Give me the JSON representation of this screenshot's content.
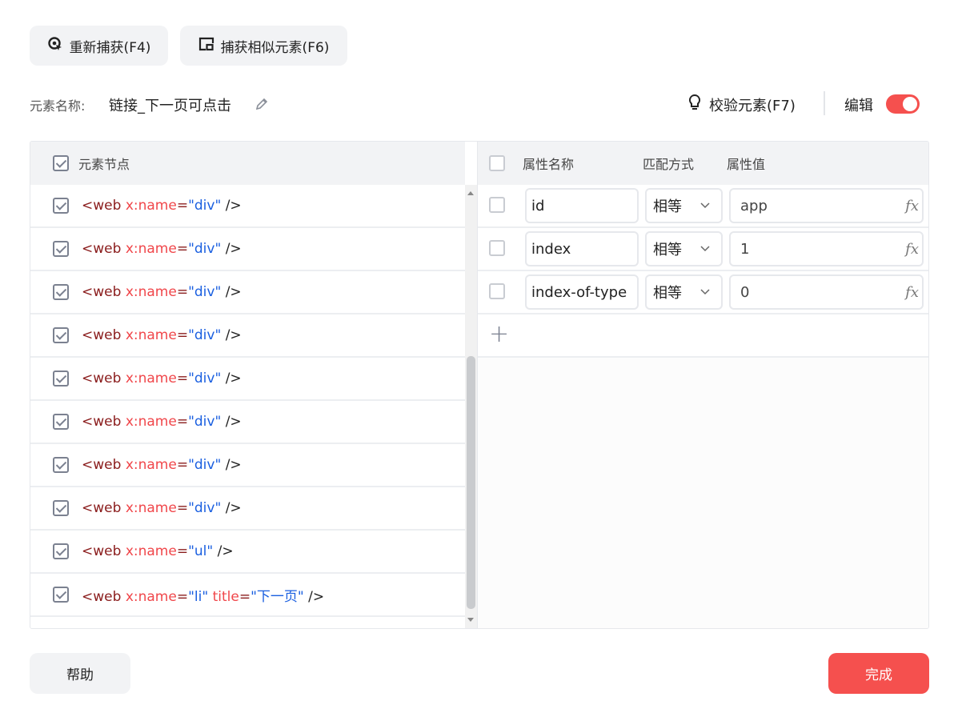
{
  "toolbar": {
    "recapture": "重新捕获(F4)",
    "capture_similar": "捕获相似元素(F6)"
  },
  "element": {
    "name_label": "元素名称:",
    "name_value": "链接_下一页可点击"
  },
  "verify": "校验元素(F7)",
  "edit": {
    "label": "编辑",
    "enabled": true
  },
  "left_header": "元素节点",
  "nodes": [
    {
      "tag": "web",
      "attrs": [
        {
          "k": "x:name",
          "v": "div"
        }
      ],
      "checked": true
    },
    {
      "tag": "web",
      "attrs": [
        {
          "k": "x:name",
          "v": "div"
        }
      ],
      "checked": true
    },
    {
      "tag": "web",
      "attrs": [
        {
          "k": "x:name",
          "v": "div"
        }
      ],
      "checked": true
    },
    {
      "tag": "web",
      "attrs": [
        {
          "k": "x:name",
          "v": "div"
        }
      ],
      "checked": true
    },
    {
      "tag": "web",
      "attrs": [
        {
          "k": "x:name",
          "v": "div"
        }
      ],
      "checked": true
    },
    {
      "tag": "web",
      "attrs": [
        {
          "k": "x:name",
          "v": "div"
        }
      ],
      "checked": true
    },
    {
      "tag": "web",
      "attrs": [
        {
          "k": "x:name",
          "v": "div"
        }
      ],
      "checked": true
    },
    {
      "tag": "web",
      "attrs": [
        {
          "k": "x:name",
          "v": "div"
        }
      ],
      "checked": true
    },
    {
      "tag": "web",
      "attrs": [
        {
          "k": "x:name",
          "v": "ul"
        }
      ],
      "checked": true
    },
    {
      "tag": "web",
      "attrs": [
        {
          "k": "x:name",
          "v": "li"
        },
        {
          "k": "title",
          "v": "下一页"
        }
      ],
      "checked": true
    }
  ],
  "right_header": {
    "name": "属性名称",
    "match": "匹配方式",
    "value": "属性值"
  },
  "attributes": [
    {
      "name": "id",
      "match": "相等",
      "value": "app",
      "checked": false
    },
    {
      "name": "index",
      "match": "相等",
      "value": "1",
      "checked": false
    },
    {
      "name": "index-of-type",
      "match": "相等",
      "value": "0",
      "checked": false
    }
  ],
  "fx": "fx",
  "footer": {
    "help": "帮助",
    "done": "完成"
  },
  "colors": {
    "accent": "#f5504e",
    "tag": "#8a1c1c",
    "attr": "#f0464a",
    "value": "#1a5fe0"
  }
}
